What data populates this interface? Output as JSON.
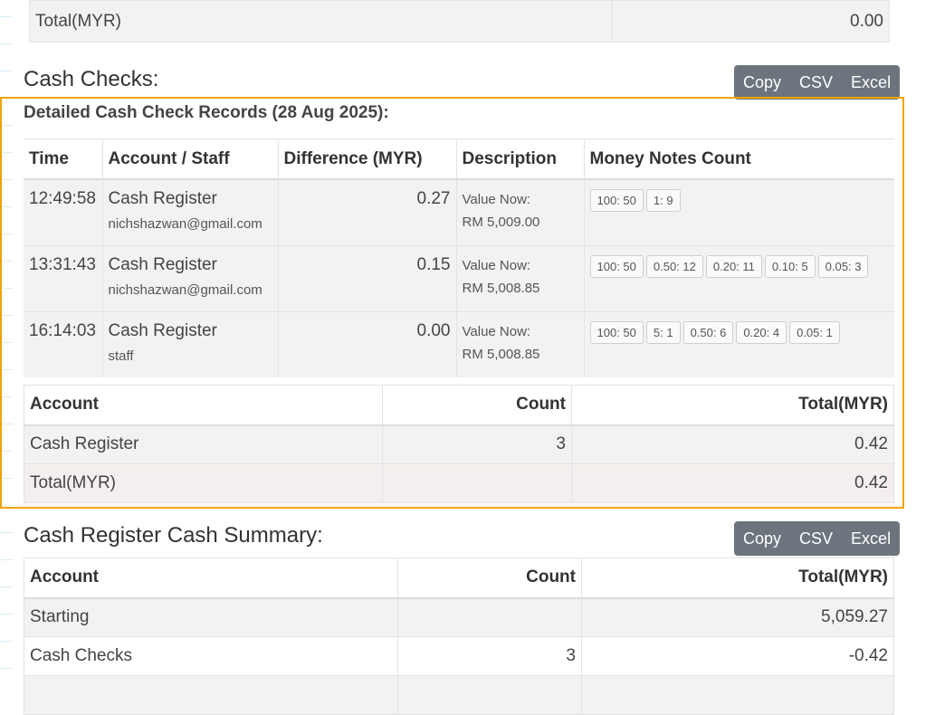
{
  "top_total": {
    "label": "Total(MYR)",
    "value": "0.00"
  },
  "cash_checks": {
    "title": "Cash Checks:",
    "export_buttons": [
      "Copy",
      "CSV",
      "Excel"
    ],
    "subtitle": "Detailed Cash Check Records (28 Aug 2025):",
    "columns": [
      "Time",
      "Account / Staff",
      "Difference (MYR)",
      "Description",
      "Money Notes Count"
    ],
    "records": [
      {
        "time": "12:49:58",
        "account": "Cash Register",
        "staff": "nichshazwan@gmail.com",
        "difference": "0.27",
        "desc_label": "Value Now:",
        "desc_value": "RM 5,009.00",
        "notes": [
          "100: 50",
          "1: 9"
        ]
      },
      {
        "time": "13:31:43",
        "account": "Cash Register",
        "staff": "nichshazwan@gmail.com",
        "difference": "0.15",
        "desc_label": "Value Now:",
        "desc_value": "RM 5,008.85",
        "notes": [
          "100: 50",
          "0.50: 12",
          "0.20: 11",
          "0.10: 5",
          "0.05: 3"
        ]
      },
      {
        "time": "16:14:03",
        "account": "Cash Register",
        "staff": "staff",
        "difference": "0.00",
        "desc_label": "Value Now:",
        "desc_value": "RM 5,008.85",
        "notes": [
          "100: 50",
          "5: 1",
          "0.50: 6",
          "0.20: 4",
          "0.05: 1"
        ]
      }
    ],
    "summary": {
      "columns": [
        "Account",
        "Count",
        "Total(MYR)"
      ],
      "rows": [
        {
          "account": "Cash Register",
          "count": "3",
          "total": "0.42"
        }
      ],
      "total": {
        "label": "Total(MYR)",
        "value": "0.42"
      }
    }
  },
  "cash_register_summary": {
    "title": "Cash Register Cash Summary:",
    "export_buttons": [
      "Copy",
      "CSV",
      "Excel"
    ],
    "columns": [
      "Account",
      "Count",
      "Total(MYR)"
    ],
    "rows": [
      {
        "account": "Starting",
        "count": "",
        "total": "5,059.27"
      },
      {
        "account": "Cash Checks",
        "count": "3",
        "total": "-0.42"
      }
    ]
  },
  "colors": {
    "highlight_border": "#f0a500",
    "button_bg": "#6c757d",
    "row_bg": "#f2f2f2",
    "total_row_bg": "#f4efee"
  }
}
